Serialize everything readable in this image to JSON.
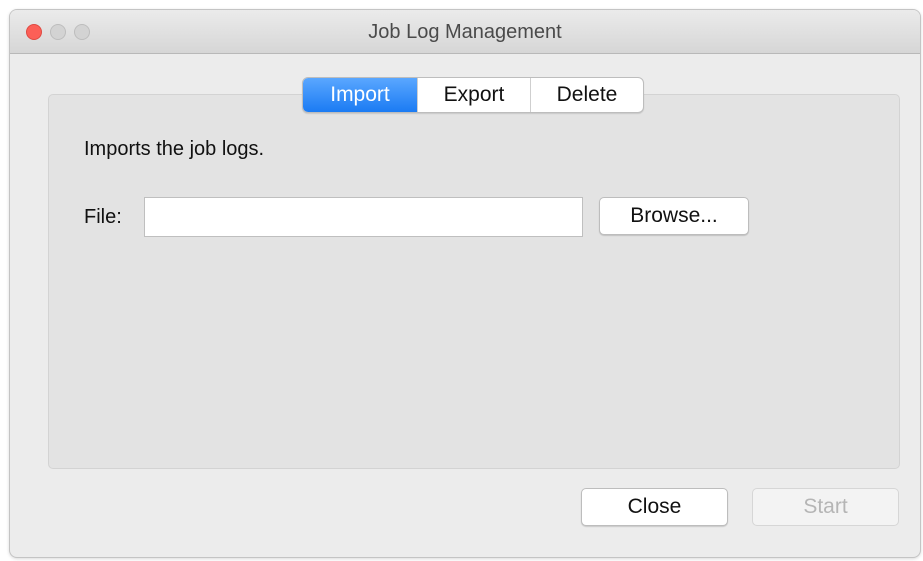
{
  "window": {
    "title": "Job Log Management"
  },
  "tabs": [
    {
      "label": "Import",
      "active": true
    },
    {
      "label": "Export",
      "active": false
    },
    {
      "label": "Delete",
      "active": false
    }
  ],
  "import_tab": {
    "description": "Imports the job logs.",
    "file_label": "File:",
    "file_value": "",
    "browse_label": "Browse..."
  },
  "footer": {
    "close_label": "Close",
    "start_label": "Start",
    "start_enabled": false
  },
  "colors": {
    "accent": "#1b7bf3",
    "close_light": "#fc5f57",
    "inactive_light": "#d3d3d3"
  }
}
